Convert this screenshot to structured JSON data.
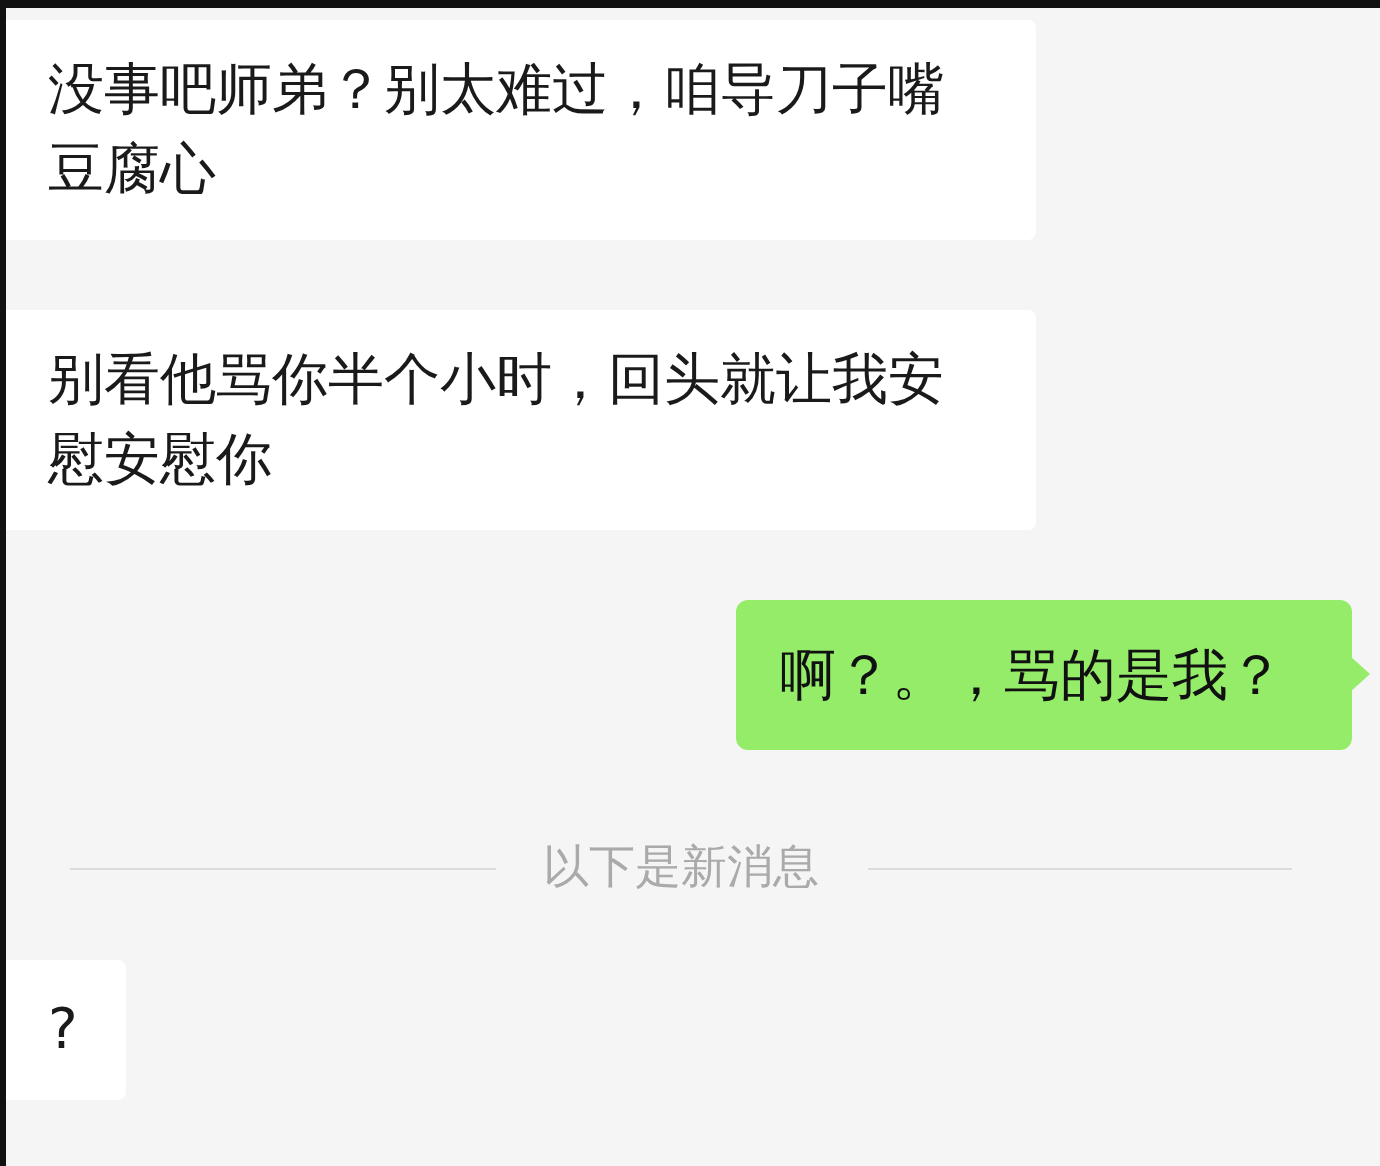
{
  "messages": [
    {
      "kind": "received",
      "text": "没事吧师弟？别太难过，咱导刀子嘴豆腐心"
    },
    {
      "kind": "received",
      "text": "别看他骂你半个小时，回头就让我安慰安慰你"
    },
    {
      "kind": "sent",
      "text": "啊？。，骂的是我？"
    },
    {
      "kind": "divider",
      "text": "以下是新消息"
    },
    {
      "kind": "received",
      "text": "?"
    }
  ]
}
